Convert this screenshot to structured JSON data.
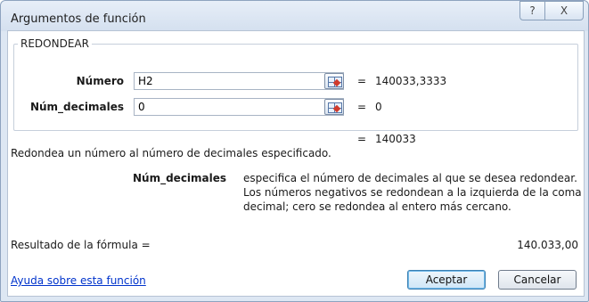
{
  "window": {
    "title": "Argumentos de función",
    "help_glyph": "?",
    "close_glyph": "X"
  },
  "function": {
    "name": "REDONDEAR",
    "args": [
      {
        "label": "Número",
        "value": "H2",
        "evaluated": "140033,3333"
      },
      {
        "label": "Núm_decimales",
        "value": "0",
        "evaluated": "0"
      }
    ],
    "equals": "=",
    "result_preview": "140033",
    "description": "Redondea un número al número de decimales especificado.",
    "arg_help": {
      "name": "Núm_decimales",
      "line1": "especifica el número de decimales al que se desea redondear.",
      "line2": "Los números negativos se redondean a la izquierda de la coma",
      "line3": "decimal; cero se redondea al entero más cercano."
    }
  },
  "formula_result": {
    "label": "Resultado de la fórmula =",
    "value": "140.033,00"
  },
  "footer": {
    "help_link": "Ayuda sobre esta función",
    "ok_label": "Aceptar",
    "cancel_label": "Cancelar"
  }
}
